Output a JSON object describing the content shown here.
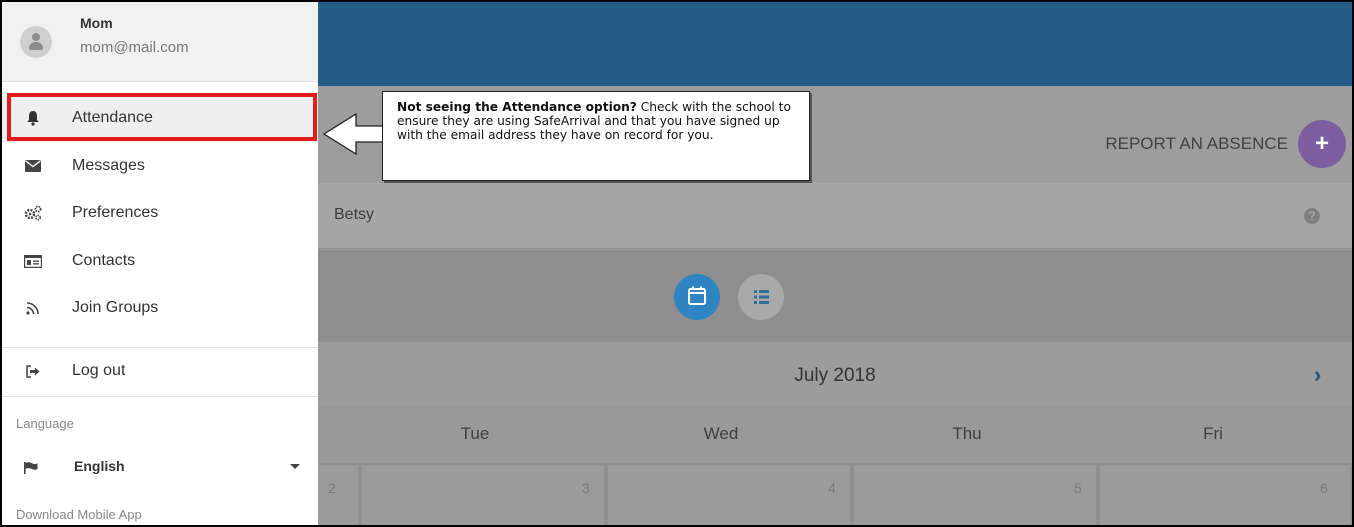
{
  "profile": {
    "name": "Mom",
    "email": "mom@mail.com"
  },
  "nav": {
    "attendance": "Attendance",
    "messages": "Messages",
    "preferences": "Preferences",
    "contacts": "Contacts",
    "join_groups": "Join Groups",
    "logout": "Log out"
  },
  "language": {
    "label": "Language",
    "value": "English"
  },
  "download_label": "Download Mobile App",
  "callout": {
    "bold": "Not seeing the Attendance option?",
    "rest": " Check with the school to ensure they are using SafeArrival and that you have signed up with the email address they have on record for you."
  },
  "report_absence": "REPORT AN ABSENCE",
  "report_plus": "+",
  "student": "Betsy",
  "help": "?",
  "calendar": {
    "month": "July 2018",
    "next": "›",
    "days": [
      "Tue",
      "Wed",
      "Thu",
      "Fri"
    ],
    "dates": [
      "2",
      "3",
      "4",
      "5",
      "6"
    ]
  },
  "colors": {
    "header": "#235d85",
    "accent_purple": "#7b5ea0",
    "accent_blue": "#2f84c1",
    "highlight": "#e31c1c"
  },
  "icons": {
    "attendance": "bell-icon",
    "messages": "envelope-icon",
    "preferences": "gears-icon",
    "contacts": "id-card-icon",
    "join_groups": "rss-icon",
    "logout": "sign-out-icon",
    "language": "flag-icon",
    "view_calendar": "calendar-icon",
    "view_list": "list-icon"
  }
}
